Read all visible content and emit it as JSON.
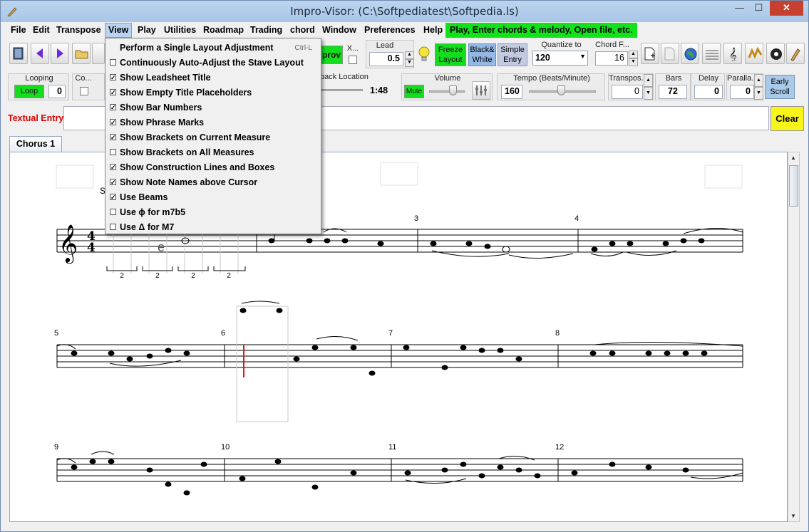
{
  "window": {
    "title": "Impro-Visor: (C:\\Softpediatest\\Softpedia.ls)",
    "minimize": "—",
    "maximize": "☐",
    "close": "✕"
  },
  "menus": [
    "File",
    "Edit",
    "Transpose",
    "View",
    "Play",
    "Utilities",
    "Roadmap",
    "Trading",
    "chord",
    "Window",
    "Preferences",
    "Help"
  ],
  "hint": "Play, Enter chords & melody, Open file, etc.",
  "toolbar1": {
    "improv_label": "prov",
    "x_label": "X...",
    "lead_label": "Lead",
    "lead_value": "0.5",
    "freeze_label": "Freeze Layout",
    "bw_label": "Black& White",
    "simple_label": "Simple Entry",
    "quantize_label": "Quantize to",
    "quantize_value": "120",
    "chord_label": "Chord F...",
    "chord_value": "16"
  },
  "toolbar2": {
    "looping_label": "Looping",
    "loop_button": "Loop",
    "loop_value": "0",
    "co_label": "Co...",
    "playback_label": "back Location",
    "playback_time": "1:48",
    "volume_label": "Volume",
    "mute_label": "Mute",
    "tempo_label": "Tempo (Beats/Minute)",
    "tempo_value": "160",
    "transpose_label": "Transpos...",
    "transpose_value": "0",
    "bars_label": "Bars",
    "bars_value": "72",
    "delay_label": "Delay",
    "delay_value": "0",
    "parallax_label": "Paralla...",
    "parallax_value": "0",
    "early_scroll": "Early Scroll"
  },
  "entry": {
    "label": "Textual Entry",
    "value": "",
    "clear": "Clear"
  },
  "tab": "Chorus 1",
  "view_menu": [
    {
      "label": "Perform a Single Layout Adjustment",
      "checkbox": false,
      "checked": false,
      "shortcut": "Ctrl-L"
    },
    {
      "label": "Continuously Auto-Adjust the Stave Layout",
      "checkbox": true,
      "checked": false,
      "shortcut": ""
    },
    {
      "label": "Show Leadsheet Title",
      "checkbox": true,
      "checked": true,
      "shortcut": ""
    },
    {
      "label": "Show Empty Title Placeholders",
      "checkbox": true,
      "checked": true,
      "shortcut": ""
    },
    {
      "label": "Show Bar Numbers",
      "checkbox": true,
      "checked": true,
      "shortcut": ""
    },
    {
      "label": "Show Phrase Marks",
      "checkbox": true,
      "checked": true,
      "shortcut": ""
    },
    {
      "label": "Show Brackets on Current Measure",
      "checkbox": true,
      "checked": true,
      "shortcut": ""
    },
    {
      "label": "Show Brackets on All Measures",
      "checkbox": true,
      "checked": false,
      "shortcut": ""
    },
    {
      "label": "Show Construction Lines and Boxes",
      "checkbox": true,
      "checked": true,
      "shortcut": ""
    },
    {
      "label": "Show Note Names above Cursor",
      "checkbox": true,
      "checked": true,
      "shortcut": ""
    },
    {
      "label": "Use Beams",
      "checkbox": true,
      "checked": true,
      "shortcut": ""
    },
    {
      "label": "Use ϕ for m7b5",
      "checkbox": true,
      "checked": false,
      "shortcut": ""
    },
    {
      "label": "Use Δ for M7",
      "checkbox": true,
      "checked": false,
      "shortcut": ""
    }
  ],
  "score": {
    "time_sig_top": "4",
    "time_sig_bottom": "4",
    "partial_label": "S",
    "triplet_labels": [
      "2",
      "2",
      "2",
      "2"
    ],
    "bar_numbers": [
      "3",
      "4",
      "5",
      "6",
      "7",
      "8",
      "9",
      "10",
      "11",
      "12"
    ]
  },
  "colors": {
    "hint_green": "#12e21a",
    "cursor_red": "#d02020",
    "clear_yellow": "#f7f51a"
  }
}
